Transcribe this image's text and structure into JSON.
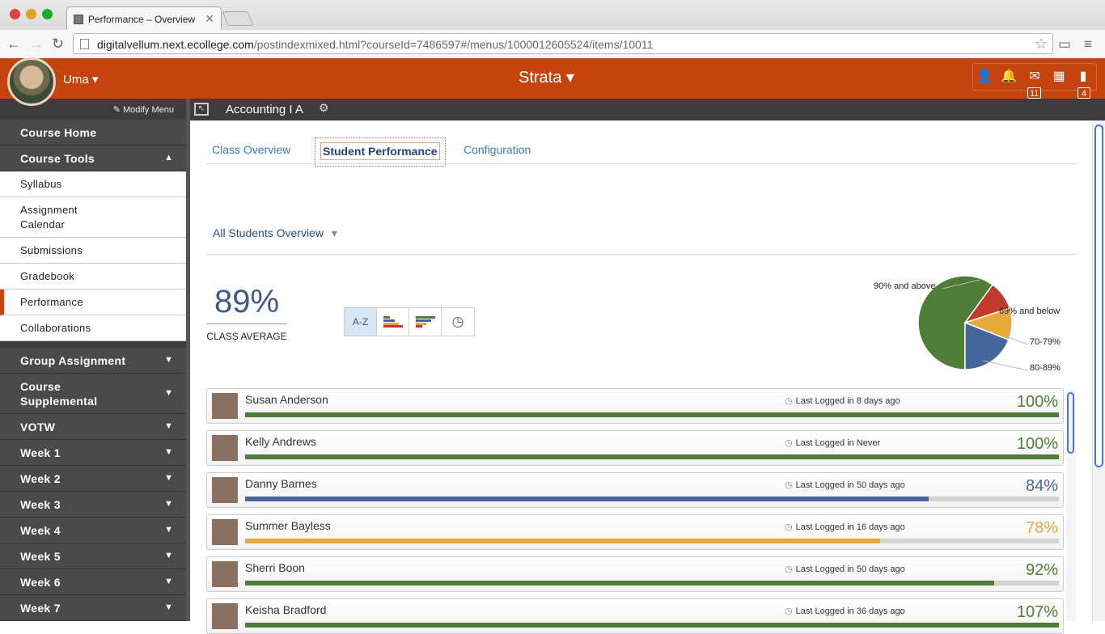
{
  "browser": {
    "tab_title": "Performance – Overview",
    "url_host": "digitalvellum.next.ecollege.com",
    "url_path": "/postindexmixed.html?courseId=7486597#/menus/1000012605524/items/10011"
  },
  "header": {
    "user_name": "Uma",
    "app_name": "Strata",
    "mail_count": "11",
    "docs_count": "4"
  },
  "sidebar": {
    "modify_menu": "Modify Menu",
    "items": [
      {
        "label": "Course Home",
        "kind": "dark"
      },
      {
        "label": "Course Tools",
        "kind": "dark",
        "expanded": true
      },
      {
        "label": "Syllabus",
        "kind": "light"
      },
      {
        "label": "Assignment\nCalendar",
        "kind": "light"
      },
      {
        "label": "Submissions",
        "kind": "light"
      },
      {
        "label": "Gradebook",
        "kind": "light"
      },
      {
        "label": "Performance",
        "kind": "light",
        "active": true
      },
      {
        "label": "Collaborations",
        "kind": "light"
      },
      {
        "label": "Group Assignment",
        "kind": "dark"
      },
      {
        "label": "Course\nSupplemental",
        "kind": "dark"
      },
      {
        "label": "VOTW",
        "kind": "dark"
      },
      {
        "label": "Week 1",
        "kind": "dark"
      },
      {
        "label": "Week 2",
        "kind": "dark"
      },
      {
        "label": "Week 3",
        "kind": "dark"
      },
      {
        "label": "Week 4",
        "kind": "dark"
      },
      {
        "label": "Week 5",
        "kind": "dark"
      },
      {
        "label": "Week 6",
        "kind": "dark"
      },
      {
        "label": "Week 7",
        "kind": "dark"
      }
    ]
  },
  "course": {
    "title": "Accounting I A"
  },
  "tabs": [
    "Class Overview",
    "Student Performance",
    "Configuration"
  ],
  "overview": {
    "dropdown": "All Students Overview",
    "class_average": "89%",
    "class_average_label": "CLASS AVERAGE",
    "sort_buttons": {
      "az": "A-Z"
    }
  },
  "chart_data": {
    "type": "pie",
    "labels": [
      "90% and above",
      "69% and below",
      "70-79%",
      "80-89%"
    ],
    "values": [
      60,
      10,
      11,
      19
    ],
    "colors": [
      "#4e7d37",
      "#c0392b",
      "#e8a93b",
      "#46669b"
    ]
  },
  "students": [
    {
      "name": "Susan Anderson",
      "last_logged": "Last Logged in 8 days ago",
      "score": "100%",
      "fraction": 1.0,
      "color": "#4e7d37"
    },
    {
      "name": "Kelly Andrews",
      "last_logged": "Last Logged in Never",
      "score": "100%",
      "fraction": 1.0,
      "color": "#4e7d37"
    },
    {
      "name": "Danny Barnes",
      "last_logged": "Last Logged in 50 days ago",
      "score": "84%",
      "fraction": 0.84,
      "color": "#46669b"
    },
    {
      "name": "Summer Bayless",
      "last_logged": "Last Logged in 16 days ago",
      "score": "78%",
      "fraction": 0.78,
      "color": "#e8a93b"
    },
    {
      "name": "Sherri Boon",
      "last_logged": "Last Logged in 50 days ago",
      "score": "92%",
      "fraction": 0.92,
      "color": "#4e7d37"
    },
    {
      "name": "Keisha Bradford",
      "last_logged": "Last Logged in 36 days ago",
      "score": "107%",
      "fraction": 1.0,
      "color": "#4e7d37"
    }
  ]
}
